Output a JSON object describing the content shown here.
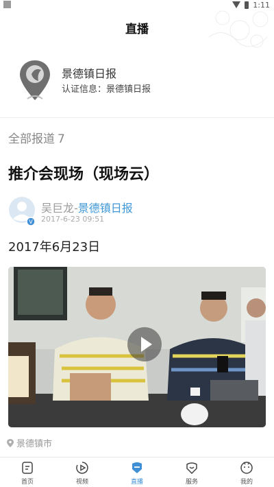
{
  "status_bar": {
    "time": "1:11"
  },
  "header": {
    "title": "直播"
  },
  "account": {
    "name": "景德镇日报",
    "cert": "认证信息：景德镇日报"
  },
  "feed": {
    "count_label": "全部报道",
    "count": "7"
  },
  "news": {
    "title": "推介会现场（现场云）",
    "author_name": "吴巨龙",
    "separator": "-",
    "source": "景德镇日报",
    "time": "2017-6-23 09:51",
    "date_text": "2017年6月23日",
    "location": "景德镇市"
  },
  "tabs": [
    {
      "label": "首页",
      "icon": "home-icon"
    },
    {
      "label": "视频",
      "icon": "video-icon"
    },
    {
      "label": "直播",
      "icon": "live-icon",
      "active": true
    },
    {
      "label": "服务",
      "icon": "service-icon"
    },
    {
      "label": "我的",
      "icon": "profile-icon"
    }
  ],
  "colors": {
    "accent": "#3e8fd6",
    "source_link": "#3e97d6",
    "muted": "#999999"
  }
}
